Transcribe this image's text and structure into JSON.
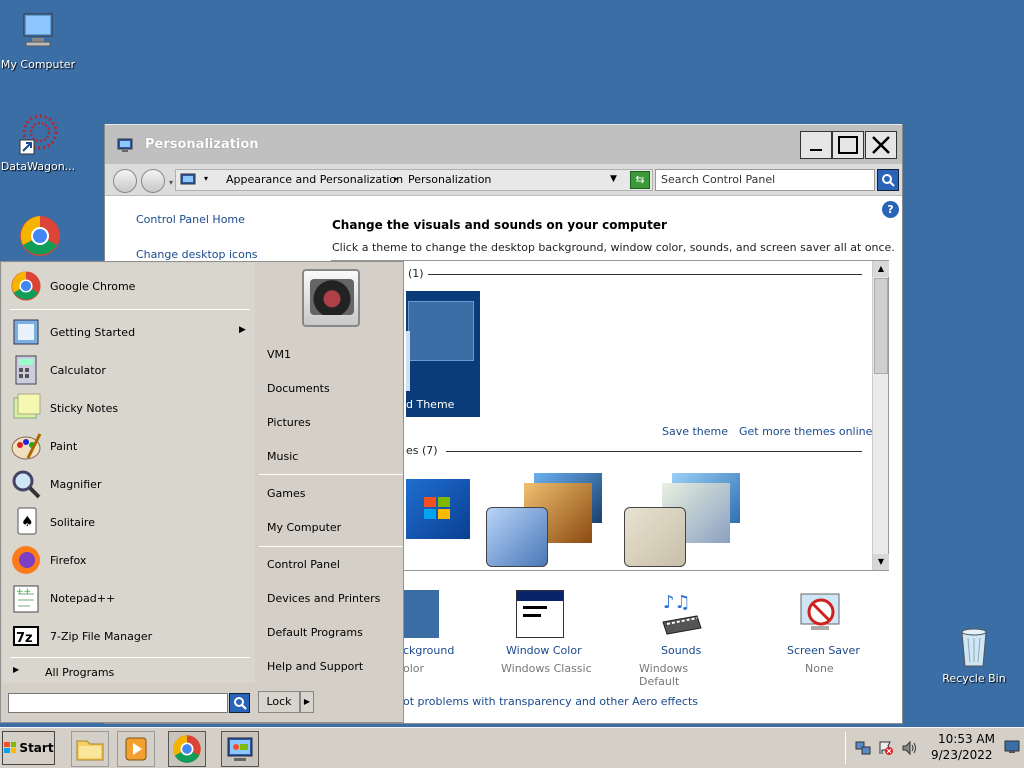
{
  "desktop": {
    "icons": [
      {
        "label": "My Computer",
        "icon": "computer-icon"
      },
      {
        "label": "DataWagon...",
        "icon": "datawagon-icon"
      },
      {
        "label": "Recycle Bin",
        "icon": "recycle-bin-icon"
      }
    ]
  },
  "window": {
    "title": "Personalization",
    "breadcrumb": [
      "Appearance and Personalization",
      "Personalization"
    ],
    "search_placeholder": "Search Control Panel",
    "sidebar": [
      "Control Panel Home",
      "Change desktop icons"
    ],
    "heading": "Change the visuals and sounds on your computer",
    "subheading": "Click a theme to change the desktop background, window color, sounds, and screen saver all at once.",
    "my_themes_count": "(1)",
    "unsaved_theme": "d Theme",
    "save_theme": "Save theme",
    "get_more": "Get more themes online",
    "aero_label": "es (7)",
    "bottom": [
      {
        "title": "ckground",
        "sub": "olor"
      },
      {
        "title": "Window Color",
        "sub": "Windows Classic"
      },
      {
        "title": "Sounds",
        "sub": "Windows Default"
      },
      {
        "title": "Screen Saver",
        "sub": "None"
      }
    ],
    "troubleshoot": "ot problems with transparency and other Aero effects"
  },
  "start_menu": {
    "pinned": "Google Chrome",
    "programs": [
      "Getting Started",
      "Calculator",
      "Sticky Notes",
      "Paint",
      "Magnifier",
      "Solitaire",
      "Firefox",
      "Notepad++",
      "7-Zip File Manager"
    ],
    "all_programs": "All Programs",
    "search_value": "",
    "right": [
      "VM1",
      "Documents",
      "Pictures",
      "Music",
      "Games",
      "My Computer",
      "Control Panel",
      "Devices and Printers",
      "Default Programs",
      "Help and Support"
    ],
    "lock": "Lock"
  },
  "taskbar": {
    "start": "Start",
    "time": "10:53 AM",
    "date": "9/23/2022"
  },
  "colors": {
    "desktop": "#3a6ea5",
    "link": "#1a4a8c",
    "theme_selected": "#0b3c7a"
  }
}
